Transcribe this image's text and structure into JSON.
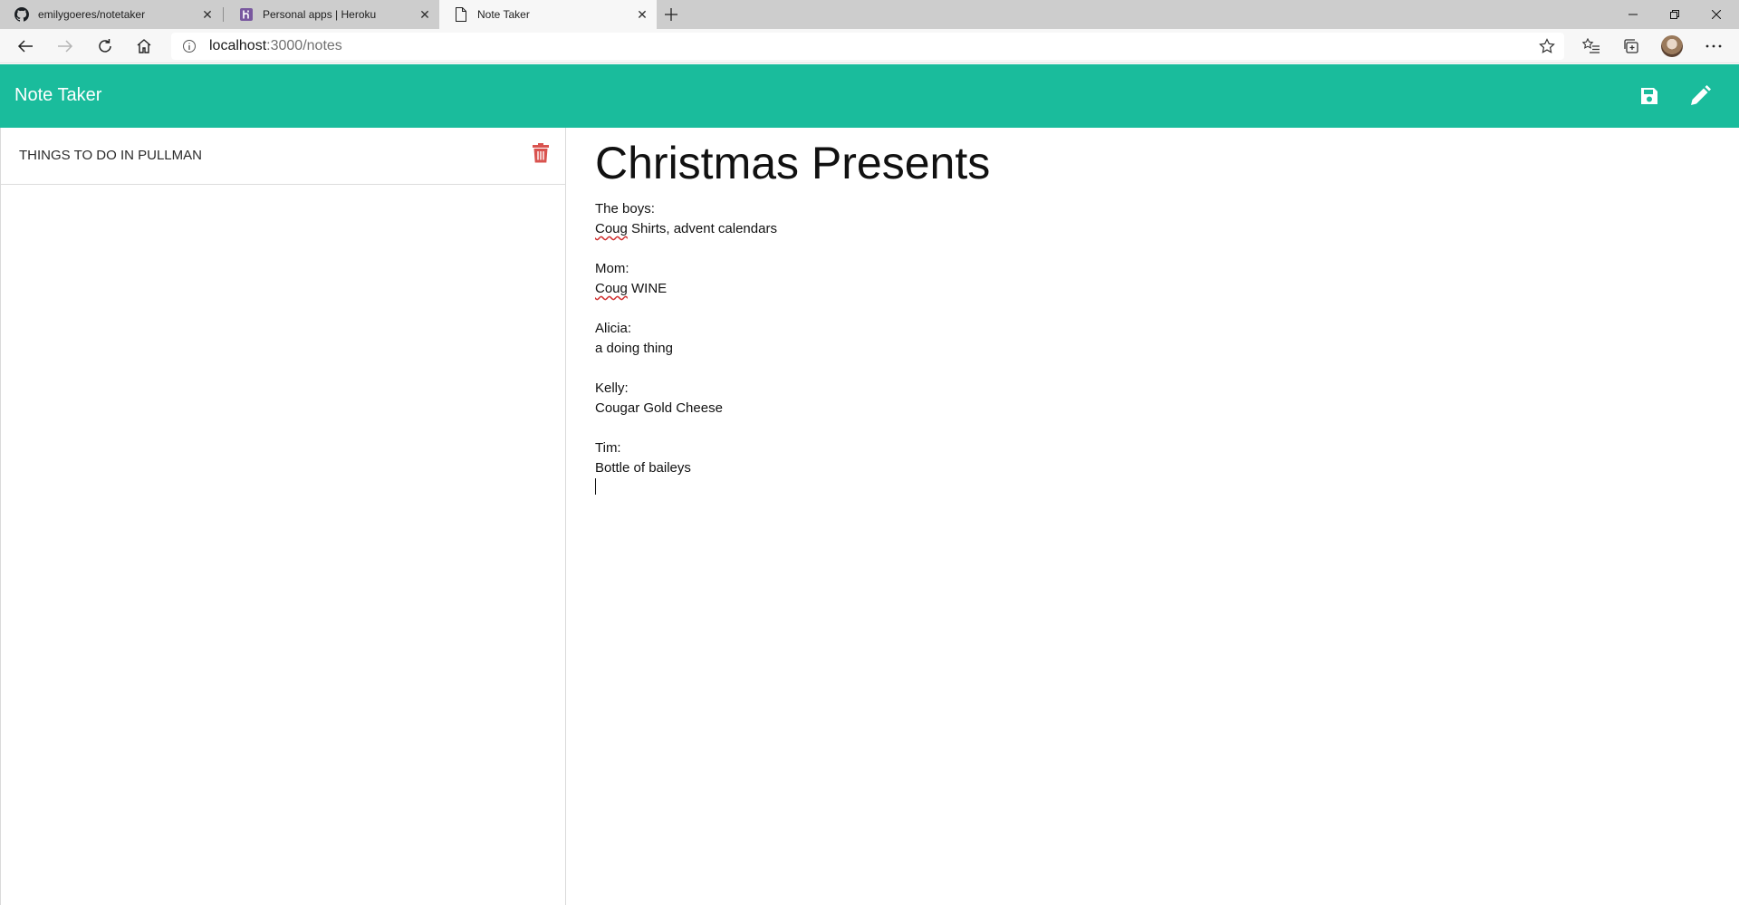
{
  "browser": {
    "tabs": [
      {
        "title": "emilygoeres/notetaker",
        "icon": "github-icon",
        "active": false
      },
      {
        "title": "Personal apps | Heroku",
        "icon": "heroku-icon",
        "active": false
      },
      {
        "title": "Note Taker",
        "icon": "page-icon",
        "active": true
      }
    ],
    "address": {
      "host": "localhost",
      "path": ":3000/notes"
    },
    "colors": {
      "tabstrip": "#cdcdcd",
      "toolbar": "#f7f7f7"
    }
  },
  "app": {
    "brand": "Note Taker",
    "accent": "#1abc9c",
    "actions": [
      "save-icon",
      "pencil-icon"
    ]
  },
  "sidebar": {
    "notes": [
      {
        "title": "THINGS TO DO IN PULLMAN",
        "delete_icon": "trash-icon",
        "delete_color": "#d9534f"
      }
    ]
  },
  "editor": {
    "title": "Christmas Presents",
    "lines": [
      {
        "text": "The boys:"
      },
      {
        "misspelled": "Coug",
        "text": " Shirts, advent calendars"
      },
      {
        "text": ""
      },
      {
        "text": "Mom:"
      },
      {
        "misspelled": "Coug",
        "text": " WINE"
      },
      {
        "text": ""
      },
      {
        "text": "Alicia:"
      },
      {
        "text": "a doing thing"
      },
      {
        "text": ""
      },
      {
        "text": "Kelly:"
      },
      {
        "text": "Cougar Gold Cheese"
      },
      {
        "text": ""
      },
      {
        "text": "Tim:"
      },
      {
        "text": "Bottle of baileys"
      }
    ]
  }
}
